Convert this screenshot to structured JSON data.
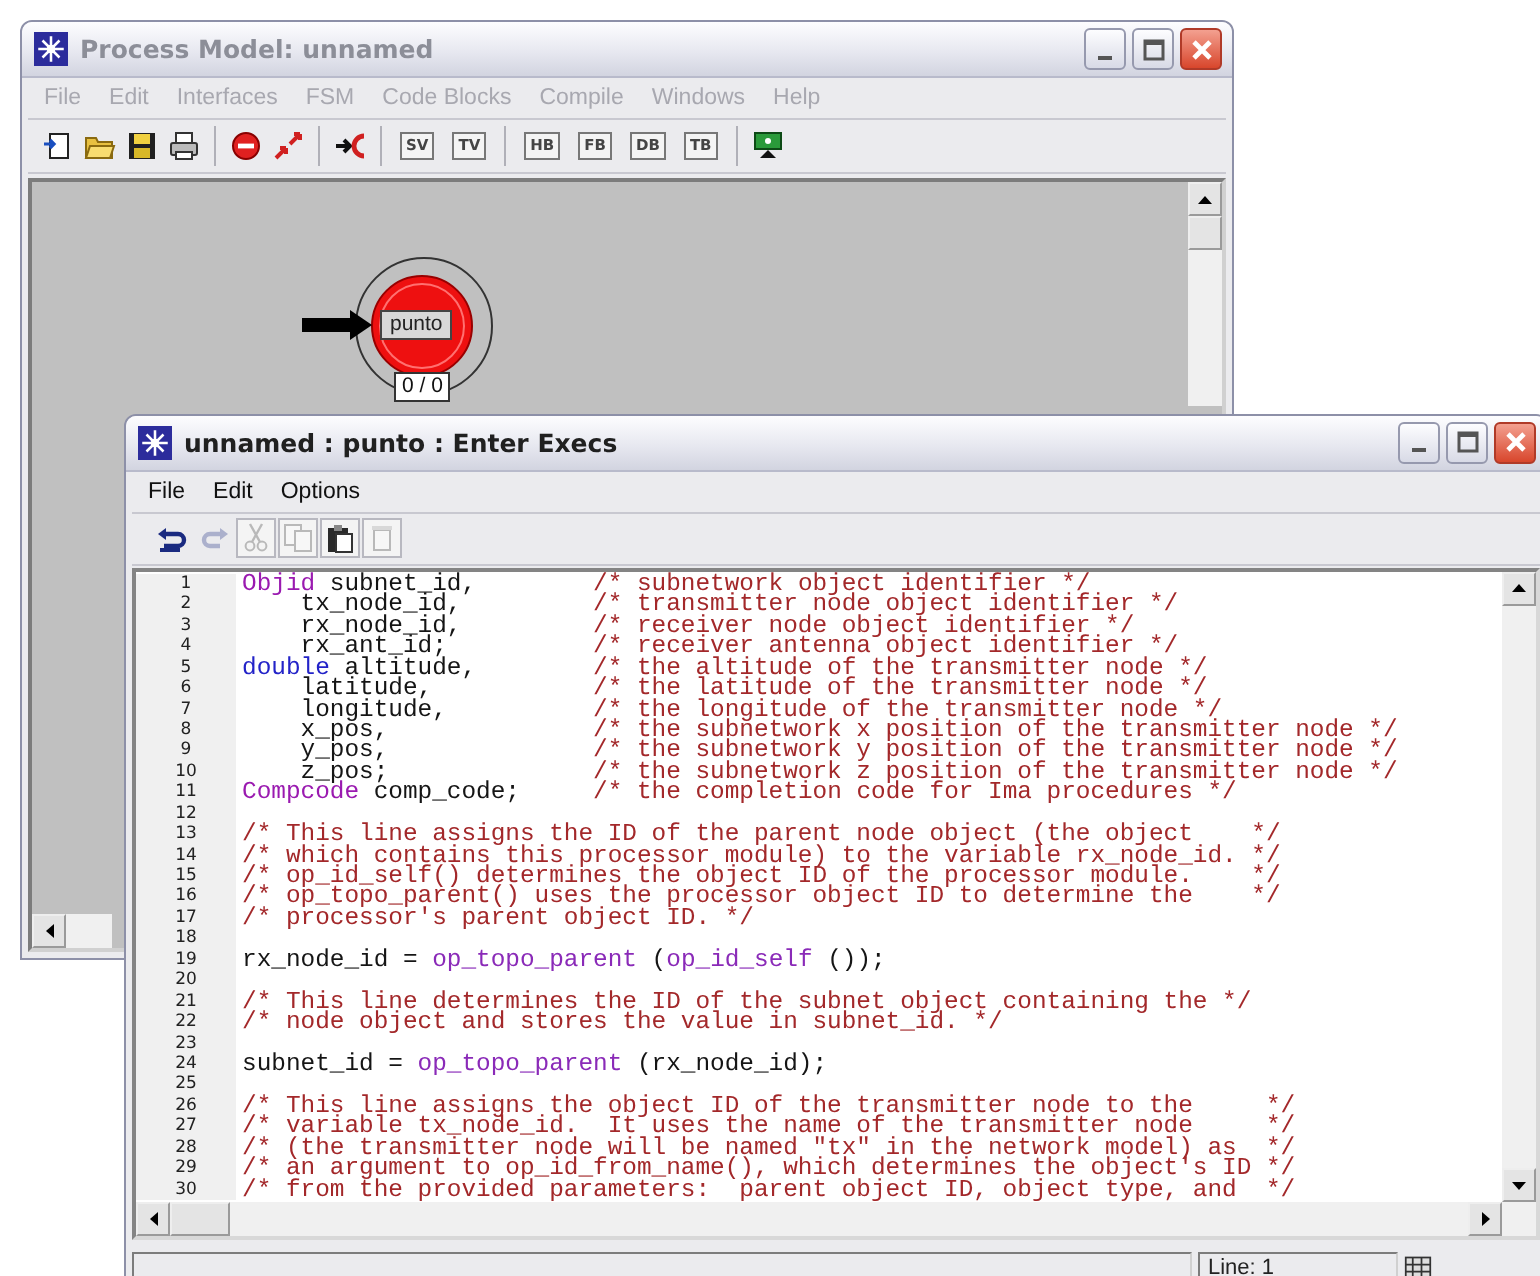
{
  "process_window": {
    "title": "Process Model: unnamed",
    "active": false,
    "menu": [
      {
        "label": "File",
        "disabled": true
      },
      {
        "label": "Edit",
        "disabled": true
      },
      {
        "label": "Interfaces",
        "disabled": true
      },
      {
        "label": "FSM",
        "disabled": true
      },
      {
        "label": "Code Blocks",
        "disabled": true
      },
      {
        "label": "Compile",
        "disabled": true
      },
      {
        "label": "Windows",
        "disabled": true
      },
      {
        "label": "Help",
        "disabled": true
      }
    ],
    "toolbar_text_buttons": [
      "SV",
      "TV",
      "HB",
      "FB",
      "DB",
      "TB"
    ],
    "states": [
      {
        "name": "punto",
        "counter": "0 / 0",
        "initial": true,
        "forced": false
      }
    ]
  },
  "exec_window": {
    "title": "unnamed : punto : Enter Execs",
    "active": true,
    "menu": [
      {
        "label": "File",
        "disabled": false
      },
      {
        "label": "Edit",
        "disabled": false
      },
      {
        "label": "Options",
        "disabled": false
      }
    ],
    "toolbar": [
      {
        "kind": "undo",
        "disabled": false
      },
      {
        "kind": "redo",
        "disabled": true
      },
      {
        "kind": "cut",
        "disabled": true
      },
      {
        "kind": "copy",
        "disabled": true
      },
      {
        "kind": "paste",
        "disabled": false
      },
      {
        "kind": "delete",
        "disabled": true
      }
    ],
    "lines": [
      {
        "number": "1",
        "segments": [
          {
            "kind": "type",
            "text": "Objid"
          },
          {
            "kind": "plain",
            "text": " subnet_id,        "
          },
          {
            "kind": "comment",
            "text": "/* subnetwork object identifier */"
          }
        ]
      },
      {
        "number": "2",
        "segments": [
          {
            "kind": "plain",
            "text": "    tx_node_id,         "
          },
          {
            "kind": "comment",
            "text": "/* transmitter node object identifier */"
          }
        ]
      },
      {
        "number": "3",
        "segments": [
          {
            "kind": "plain",
            "text": "    rx_node_id,         "
          },
          {
            "kind": "comment",
            "text": "/* receiver node object identifier */"
          }
        ]
      },
      {
        "number": "4",
        "segments": [
          {
            "kind": "plain",
            "text": "    rx_ant_id;          "
          },
          {
            "kind": "comment",
            "text": "/* receiver antenna object identifier */"
          }
        ]
      },
      {
        "number": "5",
        "segments": [
          {
            "kind": "keyword",
            "text": "double"
          },
          {
            "kind": "plain",
            "text": " altitude,        "
          },
          {
            "kind": "comment",
            "text": "/* the altitude of the transmitter node */"
          }
        ]
      },
      {
        "number": "6",
        "segments": [
          {
            "kind": "plain",
            "text": "    latitude,           "
          },
          {
            "kind": "comment",
            "text": "/* the latitude of the transmitter node */"
          }
        ]
      },
      {
        "number": "7",
        "segments": [
          {
            "kind": "plain",
            "text": "    longitude,          "
          },
          {
            "kind": "comment",
            "text": "/* the longitude of the transmitter node */"
          }
        ]
      },
      {
        "number": "8",
        "segments": [
          {
            "kind": "plain",
            "text": "    x_pos,              "
          },
          {
            "kind": "comment",
            "text": "/* the subnetwork x position of the transmitter node */"
          }
        ]
      },
      {
        "number": "9",
        "segments": [
          {
            "kind": "plain",
            "text": "    y_pos,              "
          },
          {
            "kind": "comment",
            "text": "/* the subnetwork y position of the transmitter node */"
          }
        ]
      },
      {
        "number": "10",
        "segments": [
          {
            "kind": "plain",
            "text": "    z_pos;              "
          },
          {
            "kind": "comment",
            "text": "/* the subnetwork z position of the transmitter node */"
          }
        ]
      },
      {
        "number": "11",
        "segments": [
          {
            "kind": "type",
            "text": "Compcode"
          },
          {
            "kind": "plain",
            "text": " comp_code;     "
          },
          {
            "kind": "comment",
            "text": "/* the completion code for Ima procedures */"
          }
        ]
      },
      {
        "number": "12"
      },
      {
        "number": "13",
        "segments": [
          {
            "kind": "comment",
            "text": "/* This line assigns the ID of the parent node object (the object    */"
          }
        ]
      },
      {
        "number": "14",
        "segments": [
          {
            "kind": "comment",
            "text": "/* which contains this processor module) to the variable rx_node_id. */"
          }
        ]
      },
      {
        "number": "15",
        "segments": [
          {
            "kind": "comment",
            "text": "/* op_id_self() determines the object ID of the processor module.    */"
          }
        ]
      },
      {
        "number": "16",
        "segments": [
          {
            "kind": "comment",
            "text": "/* op_topo_parent() uses the processor object ID to determine the    */"
          }
        ]
      },
      {
        "number": "17",
        "segments": [
          {
            "kind": "comment",
            "text": "/* processor's parent object ID. */"
          }
        ]
      },
      {
        "number": "18"
      },
      {
        "number": "19",
        "segments": [
          {
            "kind": "plain",
            "text": "rx_node_id = "
          },
          {
            "kind": "function",
            "text": "op_topo_parent"
          },
          {
            "kind": "plain",
            "text": " ("
          },
          {
            "kind": "function",
            "text": "op_id_self"
          },
          {
            "kind": "plain",
            "text": " ());"
          }
        ]
      },
      {
        "number": "20"
      },
      {
        "number": "21",
        "segments": [
          {
            "kind": "comment",
            "text": "/* This line determines the ID of the subnet object containing the */"
          }
        ]
      },
      {
        "number": "22",
        "segments": [
          {
            "kind": "comment",
            "text": "/* node object and stores the value in subnet_id. */"
          }
        ]
      },
      {
        "number": "23"
      },
      {
        "number": "24",
        "segments": [
          {
            "kind": "plain",
            "text": "subnet_id = "
          },
          {
            "kind": "function",
            "text": "op_topo_parent"
          },
          {
            "kind": "plain",
            "text": " (rx_node_id);"
          }
        ]
      },
      {
        "number": "25"
      },
      {
        "number": "26",
        "segments": [
          {
            "kind": "comment",
            "text": "/* This line assigns the object ID of the transmitter node to the     */"
          }
        ]
      },
      {
        "number": "27",
        "segments": [
          {
            "kind": "comment",
            "text": "/* variable tx_node_id.  It uses the name of the transmitter node     */"
          }
        ]
      },
      {
        "number": "28",
        "segments": [
          {
            "kind": "comment",
            "text": "/* (the transmitter node will be named \"tx\" in the network model) as  */"
          }
        ]
      },
      {
        "number": "29",
        "segments": [
          {
            "kind": "comment",
            "text": "/* an argument to op_id_from_name(), which determines the object's ID */"
          }
        ]
      },
      {
        "number": "30",
        "segments": [
          {
            "kind": "comment",
            "text": "/* from the provided parameters:  parent object ID, object type, and  */"
          }
        ]
      }
    ],
    "status_bar": {
      "line": "Line: 1"
    }
  }
}
